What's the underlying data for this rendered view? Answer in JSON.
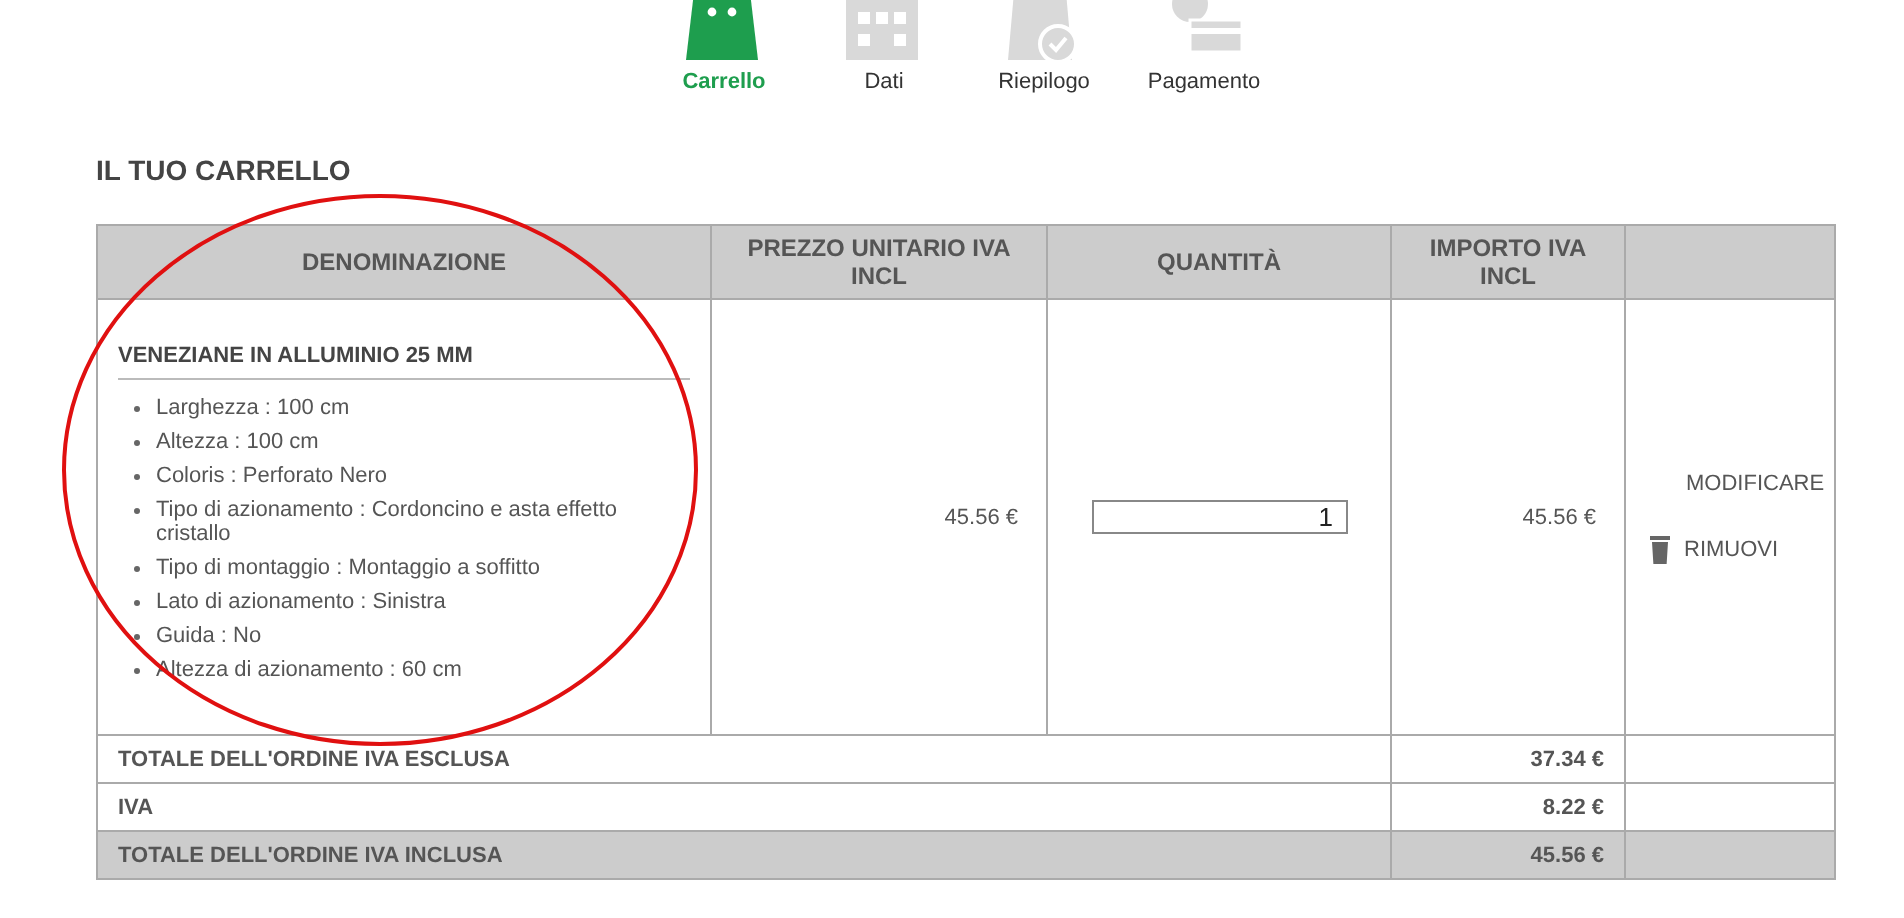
{
  "steps": [
    {
      "label": "Carrello",
      "kind": "bag",
      "selected": true
    },
    {
      "label": "Dati",
      "kind": "building",
      "selected": false
    },
    {
      "label": "Riepilogo",
      "kind": "check",
      "selected": false
    },
    {
      "label": "Pagamento",
      "kind": "card",
      "selected": false
    }
  ],
  "heading": "IL TUO CARRELLO",
  "table": {
    "columns": [
      "DENOMINAZIONE",
      "PREZZO UNITARIO IVA INCL",
      "QUANTITÀ",
      "IMPORTO IVA INCL"
    ],
    "items": [
      {
        "name": "VENEZIANE IN ALLUMINIO 25 MM",
        "attributes": [
          "Larghezza : 100 cm",
          "Altezza : 100 cm",
          "Coloris : Perforato Nero",
          "Tipo di azionamento : Cordoncino e asta effetto cristallo",
          "Tipo di montaggio : Montaggio a soffitto",
          "Lato di azionamento : Sinistra",
          "Guida : No",
          "Altezza di azionamento : 60 cm"
        ],
        "unit_price": "45.56 €",
        "quantity": "1",
        "total": "45.56 €",
        "edit": "MODIFICARE",
        "remove": "RIMUOVI"
      }
    ],
    "totals": [
      {
        "label": "TOTALE DELL'ORDINE IVA ESCLUSA",
        "value": "37.34 €",
        "kind": "plain"
      },
      {
        "label": "IVA",
        "value": "8.22 €",
        "kind": "plain"
      },
      {
        "label": "TOTALE DELL'ORDINE IVA INCLUSA",
        "value": "45.56 €",
        "kind": "grand"
      }
    ]
  },
  "annotation": {
    "kind": "ellipse"
  }
}
